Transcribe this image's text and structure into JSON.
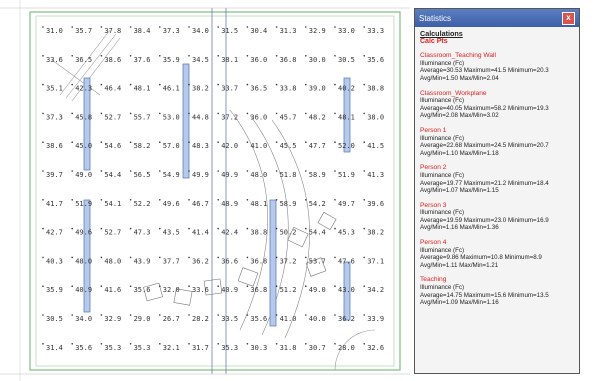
{
  "grid": {
    "rows": [
      [
        "31.0",
        "35.7",
        "37.8",
        "38.4",
        "37.3",
        "34.0",
        "31.5",
        "30.4",
        "31.3",
        "32.9",
        "33.0",
        "33.3"
      ],
      [
        "33.6",
        "36.5",
        "38.6",
        "37.6",
        "35.9",
        "34.5",
        "38.1",
        "36.0",
        "36.8",
        "30.0",
        "30.5",
        "35.6"
      ],
      [
        "35.1",
        "42.3",
        "46.4",
        "48.1",
        "46.1",
        "38.2",
        "33.7",
        "36.5",
        "33.8",
        "39.0",
        "40.2",
        "38.8"
      ],
      [
        "37.3",
        "45.8",
        "52.7",
        "55.7",
        "53.0",
        "44.8",
        "37.2",
        "36.0",
        "45.7",
        "48.2",
        "48.1",
        "38.0"
      ],
      [
        "38.6",
        "45.0",
        "54.6",
        "58.2",
        "57.0",
        "48.3",
        "42.0",
        "41.0",
        "45.5",
        "47.7",
        "52.0",
        "41.5"
      ],
      [
        "39.7",
        "49.0",
        "54.4",
        "56.5",
        "54.9",
        "49.9",
        "49.9",
        "48.0",
        "51.8",
        "58.9",
        "51.9",
        "41.3"
      ],
      [
        "41.7",
        "51.9",
        "54.1",
        "52.2",
        "49.6",
        "46.7",
        "48.9",
        "48.1",
        "58.9",
        "54.2",
        "49.7",
        "39.6"
      ],
      [
        "42.7",
        "49.6",
        "52.7",
        "47.3",
        "43.5",
        "41.4",
        "42.4",
        "38.8",
        "50.2",
        "54.4",
        "45.3",
        "38.2"
      ],
      [
        "40.3",
        "48.0",
        "48.0",
        "43.9",
        "37.7",
        "36.2",
        "36.6",
        "36.8",
        "37.2",
        "53.7",
        "47.6",
        "37.1"
      ],
      [
        "35.9",
        "40.9",
        "41.6",
        "35.6",
        "32.0",
        "33.6",
        "40.9",
        "36.8",
        "51.2",
        "49.0",
        "43.0",
        "34.2"
      ],
      [
        "30.5",
        "34.0",
        "32.9",
        "29.0",
        "26.7",
        "28.2",
        "33.5",
        "35.6",
        "41.0",
        "40.0",
        "36.2",
        "33.9"
      ],
      [
        "31.4",
        "35.6",
        "35.3",
        "35.3",
        "32.1",
        "31.7",
        "35.3",
        "30.3",
        "31.8",
        "30.7",
        "28.0",
        "32.6"
      ]
    ]
  },
  "statistics": {
    "title": "Statistics",
    "close_label": "x",
    "section_title": "Calculations",
    "calc_points": "Calc Pts",
    "blocks": [
      {
        "name": "Classroom_Teaching Wall",
        "unit": "Illuminance (Fc)",
        "l1": "Average=30.53  Maximum=41.5  Minimum=20.3",
        "l2": "Avg/Min=1.50  Max/Min=2.04"
      },
      {
        "name": "Classroom_Workplane",
        "unit": "Illuminance (Fc)",
        "l1": "Average=40.05  Maximum=58.2  Minimum=19.3",
        "l2": "Avg/Min=2.08  Max/Min=3.02"
      },
      {
        "name": "Person 1",
        "unit": "Illuminance (Fc)",
        "l1": "Average=22.68  Maximum=24.5  Minimum=20.7",
        "l2": "Avg/Min=1.10  Max/Min=1.18"
      },
      {
        "name": "Person 2",
        "unit": "Illuminance (Fc)",
        "l1": "Average=19.77  Maximum=21.2  Minimum=18.4",
        "l2": "Avg/Min=1.07  Max/Min=1.15"
      },
      {
        "name": "Person 3",
        "unit": "Illuminance (Fc)",
        "l1": "Average=19.59  Maximum=23.0  Minimum=16.9",
        "l2": "Avg/Min=1.16  Max/Min=1.36"
      },
      {
        "name": "Person 4",
        "unit": "Illuminance (Fc)",
        "l1": "Average=9.86  Maximum=10.8  Minimum=8.9",
        "l2": "Avg/Min=1.11  Max/Min=1.21"
      },
      {
        "name": "Teaching",
        "unit": "Illuminance (Fc)",
        "l1": "Average=14.75  Maximum=15.6  Minimum=13.5",
        "l2": "Avg/Min=1.09  Max/Min=1.16"
      }
    ]
  },
  "colors": {
    "fixture": "#5b82c4",
    "label_red": "#e02020",
    "wall_green": "#7fbf7f"
  }
}
